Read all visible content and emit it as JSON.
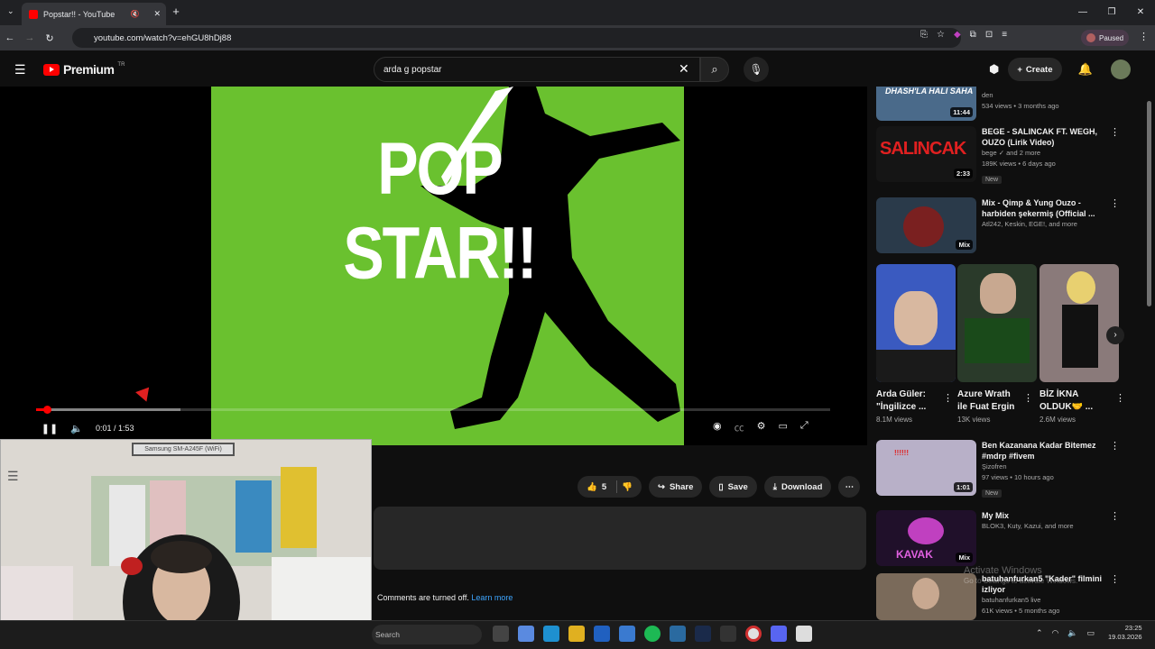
{
  "browser": {
    "tab_title": "Popstar!! - YouTube",
    "url": "youtube.com/watch?v=ehGU8hDj88",
    "profile_status": "Paused"
  },
  "youtube": {
    "logo": "Premium",
    "country": "TR",
    "search_query": "arda g popstar",
    "create_label": "Create"
  },
  "video": {
    "overlay_text": "POP STAR!!",
    "time": "0:01 / 1:53",
    "progress_fraction": 0.009
  },
  "webcam": {
    "label": "Samsung SM-A245F (WiFi)"
  },
  "actions": {
    "likes": "5",
    "share": "Share",
    "save": "Save",
    "download": "Download"
  },
  "comments": {
    "text": "Comments are turned off.",
    "link": "Learn more"
  },
  "recommendations": [
    {
      "title": "",
      "channel": "den",
      "meta": "534 views • 3 months ago",
      "duration": "11:44",
      "thumb_text": "DHASH'LA HALI SAHA"
    },
    {
      "title": "BEGE - SALINCAK FT. WEGH, OUZO (Lirik Video)",
      "channel": "bege ✓ and 2 more",
      "meta": "189K views • 6 days ago",
      "duration": "2:33",
      "badge": "New",
      "thumb_text": "SALINCAK"
    },
    {
      "title": "Mix - Qimp & Yung Ouzo - harbiden şekermiş (Official ...",
      "channel": "Atl242, Keskin, EGE!, and more",
      "meta": "",
      "duration": "Mix"
    },
    {
      "title": "Ben Kazanana Kadar Bitemez #mdrp #fivem",
      "channel": "Şizofren",
      "meta": "97 views • 10 hours ago",
      "duration": "1:01",
      "badge": "New"
    },
    {
      "title": "My Mix",
      "channel": "BLOK3, Kuty, Kazui, and more",
      "meta": "",
      "duration": "Mix",
      "thumb_text": "KAVAK"
    },
    {
      "title": "batuhanfurkan5 \"Kader\" filmini izliyor",
      "channel": "batuhanfurkan5 live",
      "meta": "61K views • 5 months ago",
      "duration": ""
    }
  ],
  "shorts": [
    {
      "title": "Arda Güler: \"İngilizce ...",
      "views": "8.1M views"
    },
    {
      "title": "Azure Wrath ile Fuat Ergin",
      "views": "13K views"
    },
    {
      "title": "BİZ İKNA OLDUK🤝 ...",
      "views": "2.6M views"
    }
  ],
  "watermark": {
    "line1": "Activate Windows",
    "line2": "Go to Settings to activate Windows."
  },
  "taskbar": {
    "search": "Search",
    "time": "23:25",
    "date": "19.03.2026"
  },
  "colors": {
    "accent": "#ff0000",
    "video_bg": "#6ac12f",
    "link": "#3ea6ff"
  }
}
